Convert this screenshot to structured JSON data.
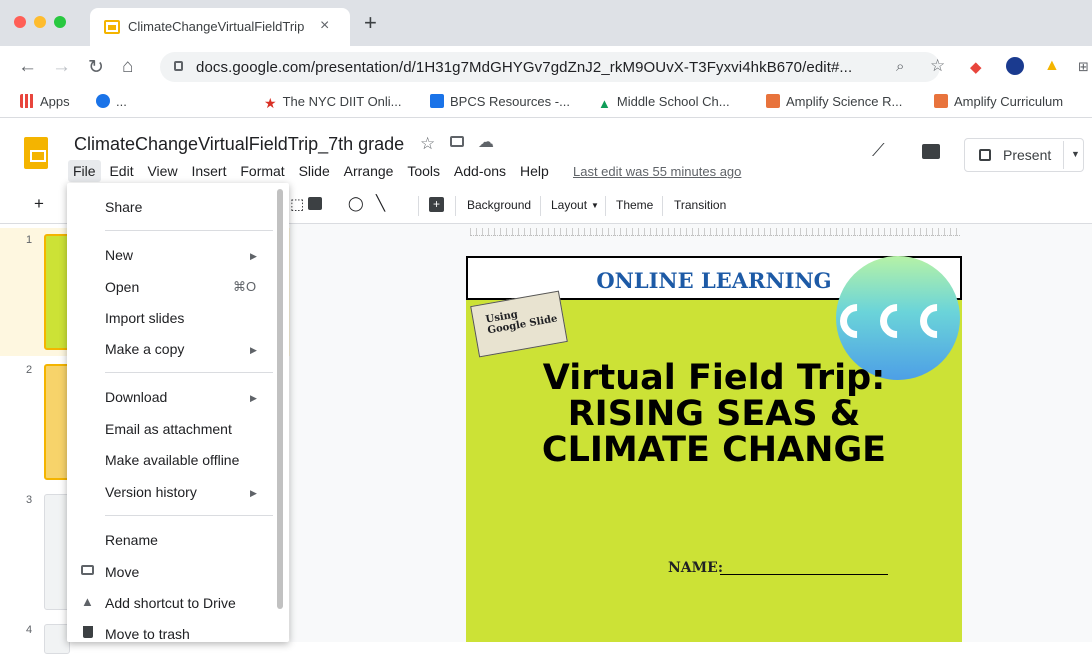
{
  "browser": {
    "tab_title": "ClimateChangeVirtualFieldTrip",
    "tab_close": "×",
    "new_tab": "+",
    "url": "docs.google.com/presentation/d/1H31g7MdGHYGv7gdZnJ2_rkM9OUvX-T3Fyxvi4hkB670/edit#...",
    "bookmarks": [
      {
        "label": "Apps",
        "icon": "apps-grid-icon"
      },
      {
        "label": "...",
        "icon": "bookmark-icon"
      },
      {
        "label": "The NYC DIIT Onli...",
        "icon": "nyc-icon"
      },
      {
        "label": "BPCS Resources -...",
        "icon": "bpcs-icon"
      },
      {
        "label": "Middle School Ch...",
        "icon": "middle-school-icon"
      },
      {
        "label": "Amplify Science R...",
        "icon": "amplify-icon"
      },
      {
        "label": "Amplify Curriculum",
        "icon": "amplify-icon"
      }
    ]
  },
  "slides": {
    "doc_title": "ClimateChangeVirtualFieldTrip_7th grade",
    "menus": [
      "File",
      "Edit",
      "View",
      "Insert",
      "Format",
      "Slide",
      "Arrange",
      "Tools",
      "Add-ons",
      "Help"
    ],
    "last_edit": "Last edit was 55 minutes ago",
    "present_label": "Present",
    "toolbar": {
      "background": "Background",
      "layout": "Layout",
      "theme": "Theme",
      "transition": "Transition"
    },
    "slide_numbers": [
      "1",
      "2",
      "3",
      "4"
    ]
  },
  "file_menu": {
    "items": [
      {
        "label": "Share"
      },
      {
        "label": "New",
        "submenu": true
      },
      {
        "label": "Open",
        "shortcut": "⌘O"
      },
      {
        "label": "Import slides"
      },
      {
        "label": "Make a copy",
        "submenu": true
      },
      {
        "label": "Download",
        "submenu": true
      },
      {
        "label": "Email as attachment"
      },
      {
        "label": "Make available offline"
      },
      {
        "label": "Version history",
        "submenu": true
      },
      {
        "label": "Rename"
      },
      {
        "label": "Move",
        "icon": "move-folder-icon"
      },
      {
        "label": "Add shortcut to Drive",
        "icon": "drive-shortcut-icon"
      },
      {
        "label": "Move to trash",
        "icon": "trash-icon"
      }
    ]
  },
  "slide_content": {
    "banner": "ONLINE LEARNING",
    "tag_line1": "Using",
    "tag_line2": "Google Slide",
    "title_line1": "Virtual Field Trip:",
    "title_line2": "RISING SEAS &",
    "title_line3": "CLIMATE CHANGE",
    "name_label": "NAME:"
  },
  "colors": {
    "slide_bg": "#cce236",
    "banner_text": "#1d5aa6",
    "slides_yellow": "#f4b400"
  }
}
